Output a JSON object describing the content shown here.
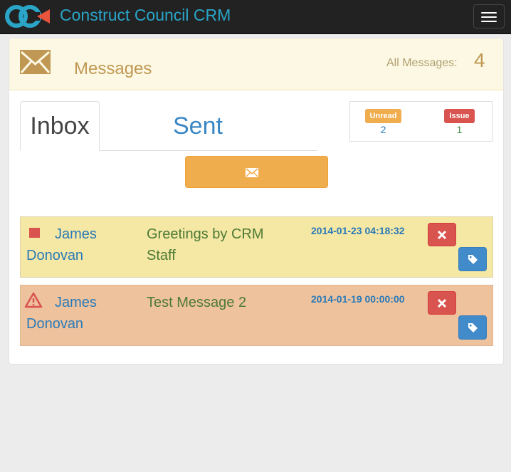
{
  "app": {
    "brand": "Construct Council CRM",
    "logo_icon": "cc-logo-icon",
    "menu_icon": "hamburger-icon"
  },
  "panel": {
    "title": "Messages",
    "title_icon": "envelope-icon",
    "all_messages_label": "All Messages:",
    "all_messages_count": "4"
  },
  "tabs": [
    {
      "label": "Inbox",
      "active": true
    },
    {
      "label": "Sent",
      "active": false
    }
  ],
  "legend": {
    "unread_label": "Unread",
    "unread_count": "2",
    "issue_label": "Issue",
    "issue_count": "1"
  },
  "compose": {
    "icon": "envelope-icon"
  },
  "messages": [
    {
      "status_icon": "square-flag-icon",
      "sender": "James Donovan",
      "subject": "Greetings by CRM Staff",
      "date": "2014-01-23 04:18:32",
      "row_color": "#f5e7a4"
    },
    {
      "status_icon": "warning-icon",
      "sender": "James Donovan",
      "subject": "Test Message 2",
      "date": "2014-01-19 00:00:00",
      "row_color": "#eec29d"
    }
  ],
  "colors": {
    "navbar": "#222222",
    "brand": "#2aa5c8",
    "warning": "#f0ad4e",
    "danger": "#d9534f",
    "primary": "#428bca"
  }
}
